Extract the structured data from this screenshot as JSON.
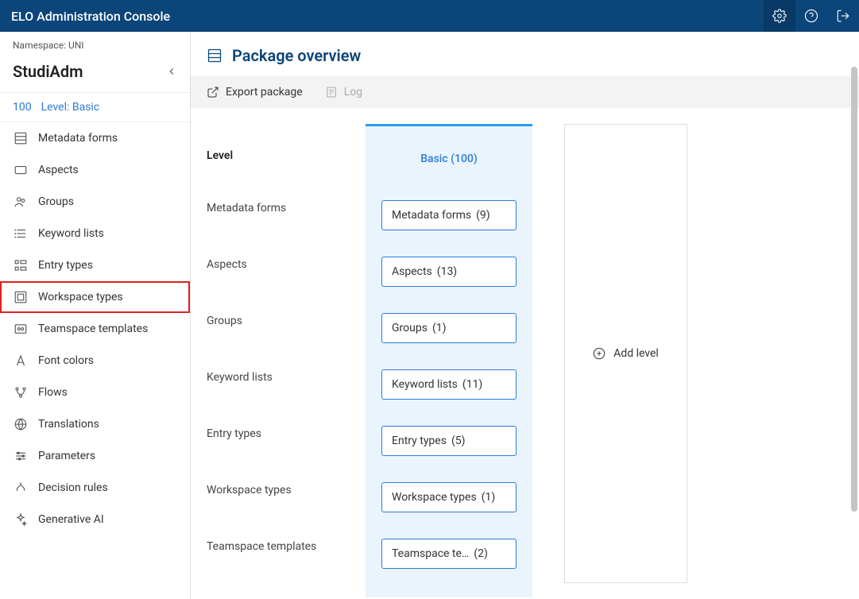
{
  "header": {
    "title": "ELO Administration Console"
  },
  "sidebar": {
    "namespace_label": "Namespace: UNI",
    "title": "StudiAdm",
    "level": {
      "id": "100",
      "name": "Level: Basic"
    },
    "items": [
      {
        "label": "Metadata forms",
        "icon": "metadata-forms-icon",
        "highlighted": false
      },
      {
        "label": "Aspects",
        "icon": "aspects-icon",
        "highlighted": false
      },
      {
        "label": "Groups",
        "icon": "groups-icon",
        "highlighted": false
      },
      {
        "label": "Keyword lists",
        "icon": "keyword-lists-icon",
        "highlighted": false
      },
      {
        "label": "Entry types",
        "icon": "entry-types-icon",
        "highlighted": false
      },
      {
        "label": "Workspace types",
        "icon": "workspace-types-icon",
        "highlighted": true
      },
      {
        "label": "Teamspace templates",
        "icon": "teamspace-templates-icon",
        "highlighted": false
      },
      {
        "label": "Font colors",
        "icon": "font-colors-icon",
        "highlighted": false
      },
      {
        "label": "Flows",
        "icon": "flows-icon",
        "highlighted": false
      },
      {
        "label": "Translations",
        "icon": "translations-icon",
        "highlighted": false
      },
      {
        "label": "Parameters",
        "icon": "parameters-icon",
        "highlighted": false
      },
      {
        "label": "Decision rules",
        "icon": "decision-rules-icon",
        "highlighted": false
      },
      {
        "label": "Generative AI",
        "icon": "generative-ai-icon",
        "highlighted": false
      }
    ]
  },
  "page": {
    "title": "Package overview",
    "toolbar": {
      "export": "Export package",
      "log": "Log"
    },
    "level_header": "Level",
    "basic_header": "Basic (100)",
    "rows": [
      {
        "label": "Metadata forms",
        "cell_name": "Metadata forms",
        "count": "(9)"
      },
      {
        "label": "Aspects",
        "cell_name": "Aspects",
        "count": "(13)"
      },
      {
        "label": "Groups",
        "cell_name": "Groups",
        "count": "(1)"
      },
      {
        "label": "Keyword lists",
        "cell_name": "Keyword lists",
        "count": "(11)"
      },
      {
        "label": "Entry types",
        "cell_name": "Entry types",
        "count": "(5)"
      },
      {
        "label": "Workspace types",
        "cell_name": "Workspace types",
        "count": "(1)"
      },
      {
        "label": "Teamspace templates",
        "cell_name": "Teamspace te…",
        "count": "(2)"
      }
    ],
    "add_level": "Add level"
  }
}
